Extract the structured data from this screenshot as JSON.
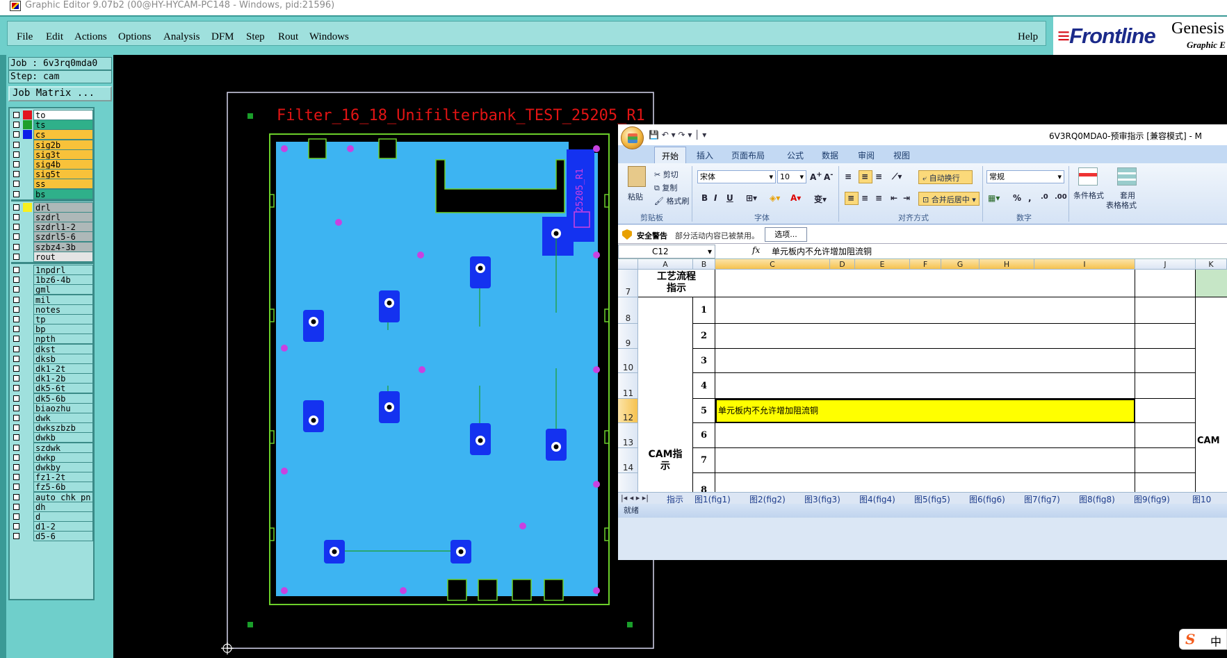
{
  "window": {
    "title": "Graphic Editor 9.07b2 (00@HY-HYCAM-PC148 - Windows, pid:21596)"
  },
  "menu": {
    "items": [
      "File",
      "Edit",
      "Actions",
      "Options",
      "Analysis",
      "DFM",
      "Step",
      "Rout",
      "Windows"
    ],
    "help": "Help"
  },
  "brand": {
    "frontline": "Frontline",
    "product": "Genesis",
    "sub": "Graphic E"
  },
  "job": {
    "job_line": "Job : 6v3rq0mda0",
    "step_line": "Step: cam",
    "matrix_button": "Job Matrix ..."
  },
  "layers": [
    {
      "name": "to",
      "color": "#e2141e",
      "bg": "#ffffff"
    },
    {
      "name": "ts",
      "color": "#1e9e2a",
      "bg": "#2fb08a"
    },
    {
      "name": "cs",
      "color": "#0a1ee8",
      "bg": "#f8c23a"
    },
    {
      "name": "sig2b",
      "color": "",
      "bg": "#f8c23a"
    },
    {
      "name": "sig3t",
      "color": "",
      "bg": "#f8c23a"
    },
    {
      "name": "sig4b",
      "color": "",
      "bg": "#f8c23a"
    },
    {
      "name": "sig5t",
      "color": "",
      "bg": "#f8c23a"
    },
    {
      "name": "ss",
      "color": "",
      "bg": "#f8c23a"
    },
    {
      "name": "bs",
      "color": "",
      "bg": "#2fb08a"
    },
    {
      "name": "drl",
      "color": "#f8f01e",
      "bg": "#aeb8b8"
    },
    {
      "name": "szdrl",
      "color": "",
      "bg": "#aeb8b8"
    },
    {
      "name": "szdrl1-2",
      "color": "",
      "bg": "#aeb8b8"
    },
    {
      "name": "szdrl5-6",
      "color": "",
      "bg": "#aeb8b8"
    },
    {
      "name": "szbz4-3b",
      "color": "",
      "bg": "#aeb8b8"
    },
    {
      "name": "rout",
      "color": "",
      "bg": "#e4e4e4"
    },
    {
      "name": "1npdrl",
      "color": "",
      "bg": "#9fe0dd"
    },
    {
      "name": "1bz6-4b",
      "color": "",
      "bg": "#9fe0dd"
    },
    {
      "name": "gml",
      "color": "",
      "bg": "#9fe0dd"
    },
    {
      "name": "mil",
      "color": "",
      "bg": "#9fe0dd"
    },
    {
      "name": "notes",
      "color": "",
      "bg": "#9fe0dd"
    },
    {
      "name": "tp",
      "color": "",
      "bg": "#9fe0dd"
    },
    {
      "name": "bp",
      "color": "",
      "bg": "#9fe0dd"
    },
    {
      "name": "npth",
      "color": "",
      "bg": "#9fe0dd"
    },
    {
      "name": "dkst",
      "color": "",
      "bg": "#9fe0dd"
    },
    {
      "name": "dksb",
      "color": "",
      "bg": "#9fe0dd"
    },
    {
      "name": "dk1-2t",
      "color": "",
      "bg": "#9fe0dd"
    },
    {
      "name": "dk1-2b",
      "color": "",
      "bg": "#9fe0dd"
    },
    {
      "name": "dk5-6t",
      "color": "",
      "bg": "#9fe0dd"
    },
    {
      "name": "dk5-6b",
      "color": "",
      "bg": "#9fe0dd"
    },
    {
      "name": "biaozhu",
      "color": "",
      "bg": "#9fe0dd"
    },
    {
      "name": "dwk",
      "color": "",
      "bg": "#9fe0dd"
    },
    {
      "name": "dwkszbzb",
      "color": "",
      "bg": "#9fe0dd"
    },
    {
      "name": "dwkb",
      "color": "",
      "bg": "#9fe0dd"
    },
    {
      "name": "szdwk",
      "color": "",
      "bg": "#9fe0dd"
    },
    {
      "name": "dwkp",
      "color": "",
      "bg": "#9fe0dd"
    },
    {
      "name": "dwkby",
      "color": "",
      "bg": "#9fe0dd"
    },
    {
      "name": "fz1-2t",
      "color": "",
      "bg": "#9fe0dd"
    },
    {
      "name": "fz5-6b",
      "color": "",
      "bg": "#9fe0dd"
    },
    {
      "name": "auto_chk_pn",
      "color": "",
      "bg": "#9fe0dd"
    },
    {
      "name": "dh",
      "color": "",
      "bg": "#9fe0dd"
    },
    {
      "name": "d",
      "color": "",
      "bg": "#9fe0dd"
    },
    {
      "name": "d1-2",
      "color": "",
      "bg": "#9fe0dd"
    },
    {
      "name": "d5-6",
      "color": "",
      "bg": "#9fe0dd"
    }
  ],
  "board": {
    "title": "Filter_16_18_Unifilterbank_TEST_25205_R1",
    "side_label": "25205_R1"
  },
  "excel": {
    "doc_title": "6V3RQ0MDA0-预审指示  [兼容模式] - M",
    "tabs": [
      "开始",
      "插入",
      "页面布局",
      "公式",
      "数据",
      "审阅",
      "视图"
    ],
    "clipboard": {
      "paste": "粘贴",
      "cut": "剪切",
      "copy": "复制",
      "format_painter": "格式刷",
      "label": "剪贴板"
    },
    "font": {
      "name": "宋体",
      "size": "10",
      "label": "字体"
    },
    "align": {
      "wrap": "自动换行",
      "merge": "合并后居中",
      "label": "对齐方式"
    },
    "number": {
      "format": "常规",
      "label": "数字"
    },
    "styles": {
      "cond": "条件格式",
      "table1": "套用",
      "table2": "表格格式"
    },
    "security": {
      "title": "安全警告",
      "message": "部分活动内容已被禁用。",
      "options": "选项..."
    },
    "namebox": "C12",
    "fx": "fx",
    "formula": "单元板内不允许增加阻流铜",
    "columns": [
      "A",
      "B",
      "C",
      "D",
      "E",
      "F",
      "G",
      "H",
      "I",
      "J",
      "K"
    ],
    "rows": [
      "7",
      "8",
      "9",
      "10",
      "11",
      "12",
      "13",
      "14"
    ],
    "header_cell": "工艺流程\n指示",
    "cam_label": "CAM指\n示",
    "cam_label_k": "CAM",
    "items": [
      "1",
      "2",
      "3",
      "4",
      "5",
      "6",
      "7",
      "8"
    ],
    "highlight_text": "单元板内不允许增加阻流铜",
    "sheets": [
      "指示",
      "图1(fig1)",
      "图2(fig2)",
      "图3(fig3)",
      "图4(fig4)",
      "图5(fig5)",
      "图6(fig6)",
      "图7(fig7)",
      "图8(fig8)",
      "图9(fig9)",
      "图10"
    ],
    "status": "就绪"
  },
  "ime": {
    "mode": "中",
    "logo": "S"
  }
}
